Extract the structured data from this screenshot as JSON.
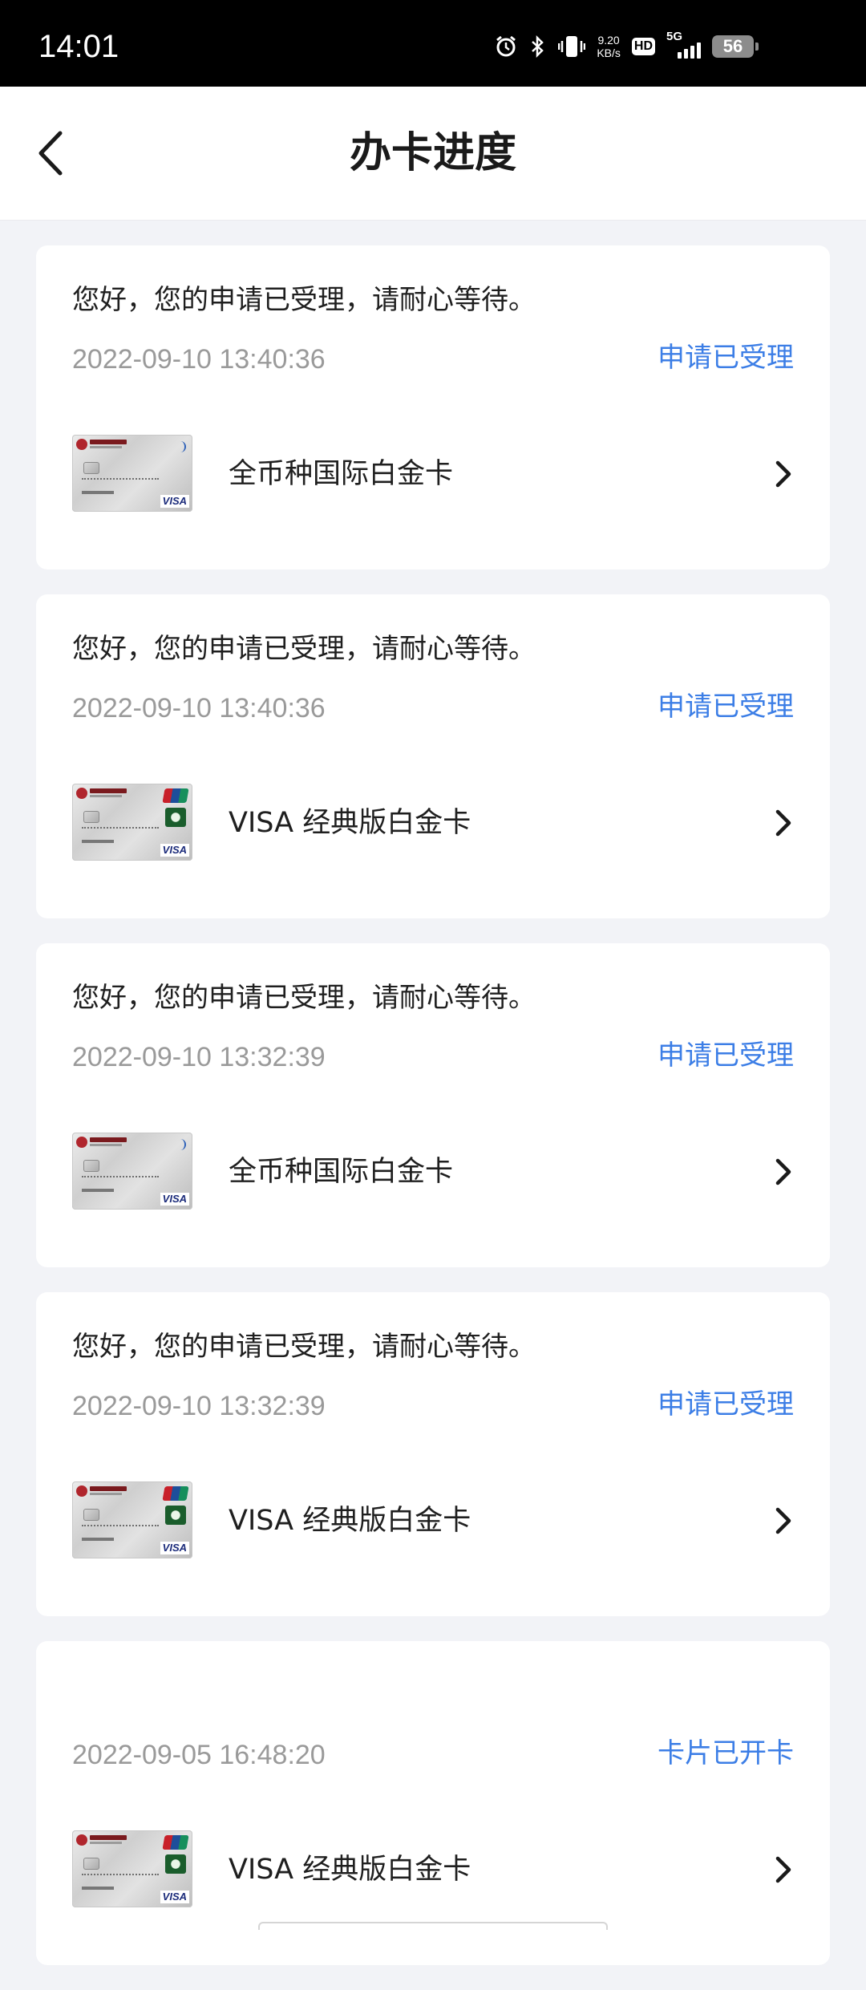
{
  "status_bar": {
    "time": "14:01",
    "net_speed_value": "9.20",
    "net_speed_unit": "KB/s",
    "hd_label": "HD",
    "network_label": "5G",
    "battery_level": "56",
    "icons": [
      "alarm-icon",
      "bluetooth-icon",
      "vibrate-icon",
      "hd-icon",
      "signal-5g-icon",
      "battery-icon"
    ]
  },
  "header": {
    "title": "办卡进度",
    "back_icon": "chevron-left-icon"
  },
  "colors": {
    "status_accent": "#3c7ee6",
    "timestamp_gray": "#9a9a9a",
    "page_background": "#f2f3f7"
  },
  "cards": [
    {
      "message": "您好，您的申请已受理，请耐心等待。",
      "time": "2022-09-10 13:40:36",
      "status": "申请已受理",
      "card_name": "全币种国际白金卡",
      "card_style": "contactless-visa"
    },
    {
      "message": "您好，您的申请已受理，请耐心等待。",
      "time": "2022-09-10 13:40:36",
      "status": "申请已受理",
      "card_name": "VISA 经典版白金卡",
      "card_style": "unionpay-visa"
    },
    {
      "message": "您好，您的申请已受理，请耐心等待。",
      "time": "2022-09-10 13:32:39",
      "status": "申请已受理",
      "card_name": "全币种国际白金卡",
      "card_style": "contactless-visa"
    },
    {
      "message": "您好，您的申请已受理，请耐心等待。",
      "time": "2022-09-10 13:32:39",
      "status": "申请已受理",
      "card_name": "VISA 经典版白金卡",
      "card_style": "unionpay-visa"
    },
    {
      "message": "",
      "time": "2022-09-05 16:48:20",
      "status": "卡片已开卡",
      "card_name": "VISA 经典版白金卡",
      "card_style": "unionpay-visa"
    }
  ],
  "card_thumb_brand": "VISA"
}
